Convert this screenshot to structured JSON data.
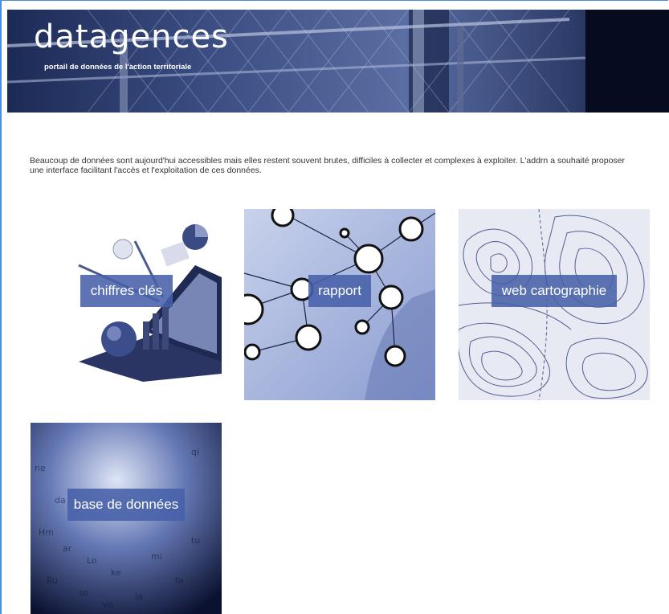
{
  "header": {
    "logo_text": "datagences",
    "subtitle": "portail de données de l'action territoriale"
  },
  "intro": {
    "text": "Beaucoup de données sont aujourd'hui accessibles mais elles restent souvent brutes, difficiles à collecter et complexes à exploiter. L'addrn a souhaité proposer une interface facilitant l'accès et l'exploitation de ces données."
  },
  "tiles": [
    {
      "label": "chiffres clés",
      "icon": "laptop-globe-chart-image"
    },
    {
      "label": "rapport",
      "icon": "network-icons-image"
    },
    {
      "label": "web cartographie",
      "icon": "topographic-map-image"
    },
    {
      "label": "base de données",
      "icon": "letters-cloud-image"
    }
  ],
  "colors": {
    "tile_label_bg": "#4760a8",
    "accent_border": "#4a90d9"
  }
}
